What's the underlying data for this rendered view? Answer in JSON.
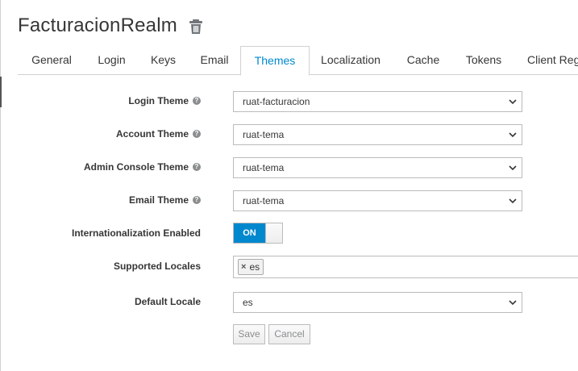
{
  "realm": {
    "title": "FacturacionRealm"
  },
  "tabs": [
    {
      "label": "General"
    },
    {
      "label": "Login"
    },
    {
      "label": "Keys"
    },
    {
      "label": "Email"
    },
    {
      "label": "Themes"
    },
    {
      "label": "Localization"
    },
    {
      "label": "Cache"
    },
    {
      "label": "Tokens"
    },
    {
      "label": "Client Reg"
    }
  ],
  "active_tab": "Themes",
  "form": {
    "login_theme": {
      "label": "Login Theme",
      "value": "ruat-facturacion"
    },
    "account_theme": {
      "label": "Account Theme",
      "value": "ruat-tema"
    },
    "admin_console_theme": {
      "label": "Admin Console Theme",
      "value": "ruat-tema"
    },
    "email_theme": {
      "label": "Email Theme",
      "value": "ruat-tema"
    },
    "internationalization": {
      "label": "Internationalization Enabled",
      "state": "ON"
    },
    "supported_locales": {
      "label": "Supported Locales",
      "tags": [
        "es"
      ],
      "remove_glyph": "×"
    },
    "default_locale": {
      "label": "Default Locale",
      "value": "es"
    }
  },
  "help_glyph": "?",
  "buttons": {
    "save": "Save",
    "cancel": "Cancel"
  },
  "colors": {
    "accent": "#0088ce",
    "text": "#363636",
    "disabled_text": "#8b8d8f",
    "border": "#bbbbbb"
  },
  "icons": {
    "delete": "trash-icon",
    "help": "help-icon",
    "dropdown": "chevron-down-icon",
    "remove": "close-icon"
  }
}
